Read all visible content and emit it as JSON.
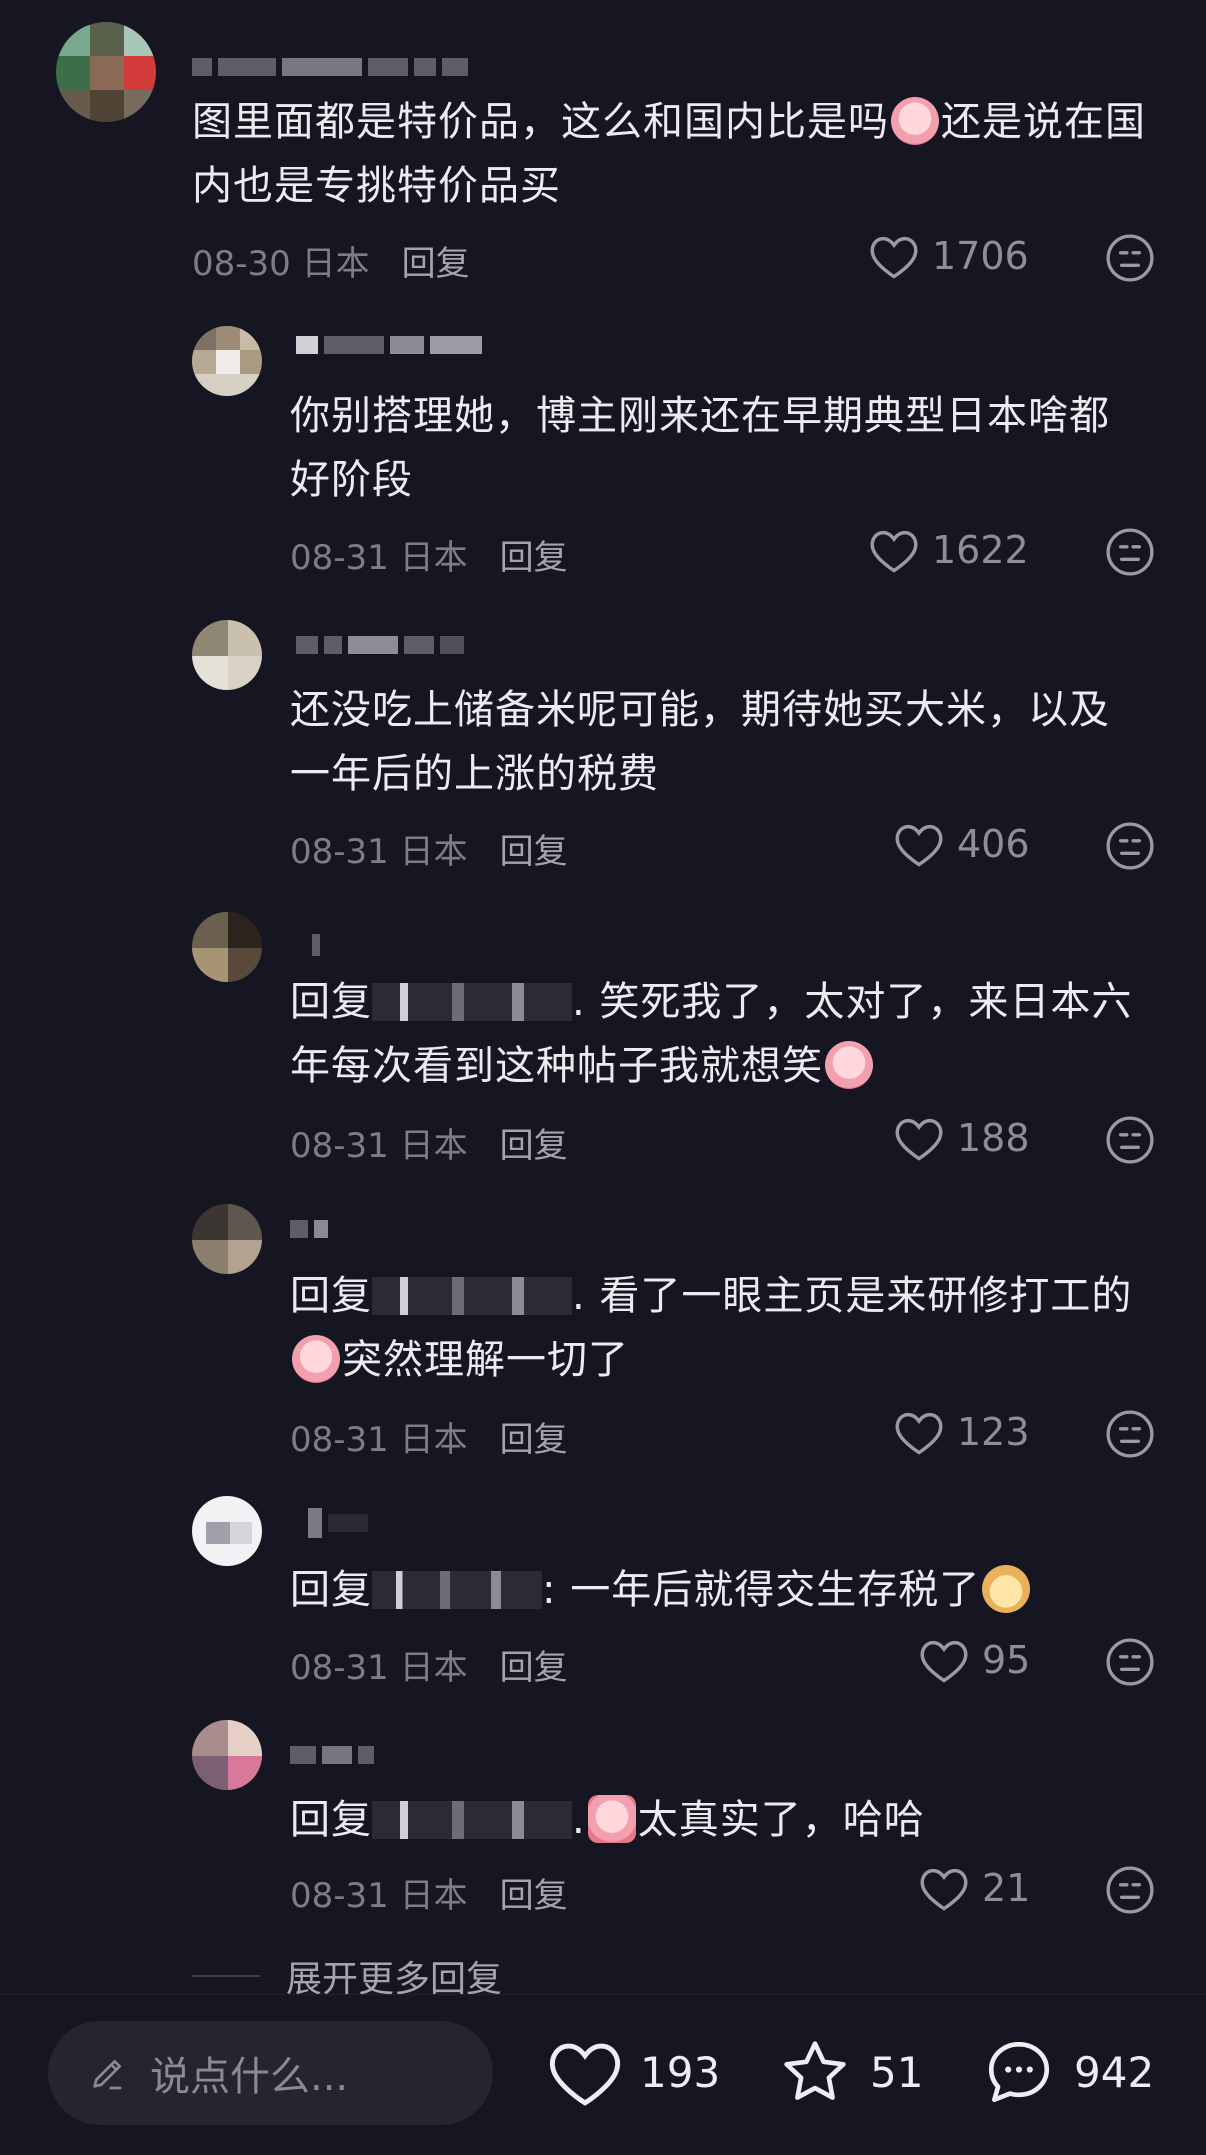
{
  "comments": [
    {
      "text_a": "图里面都是特价品，这么和国内比是吗",
      "text_b": "还是说在国内也是专挑特价品买",
      "date": "08-30 日本",
      "reply": "回复",
      "likes": "1706"
    },
    {
      "text": "你别搭理她，博主刚来还在早期典型日本啥都好阶段",
      "date": "08-31 日本",
      "reply": "回复",
      "likes": "1622"
    },
    {
      "text": "还没吃上储备米呢可能，期待她买大米，以及一年后的上涨的税费",
      "date": "08-31 日本",
      "reply": "回复",
      "likes": "406"
    },
    {
      "prefix": "回复",
      "text_a": ". 笑死我了，太对了，来日本六年每次看到这种帖子我就想笑",
      "date": "08-31 日本",
      "reply": "回复",
      "likes": "188"
    },
    {
      "prefix": "回复",
      "text_a": ". 看了一眼主页是来研修打工的",
      "text_b": "突然理解一切了",
      "date": "08-31 日本",
      "reply": "回复",
      "likes": "123"
    },
    {
      "prefix": "回复",
      "text_a": ": 一年后就得交生存税了",
      "date": "08-31 日本",
      "reply": "回复",
      "likes": "95"
    },
    {
      "prefix": "回复",
      "text_a": ".",
      "text_b": "太真实了，哈哈",
      "date": "08-31 日本",
      "reply": "回复",
      "likes": "21"
    }
  ],
  "more_replies": "展开更多回复",
  "bottom_bar": {
    "input_placeholder": "说点什么...",
    "likes": "193",
    "stars": "51",
    "comments": "942"
  },
  "icons": {
    "like": "heart-icon",
    "reaction": "meh-face-icon",
    "edit": "pencil-icon",
    "star": "star-icon",
    "comment": "chat-bubble-icon"
  }
}
